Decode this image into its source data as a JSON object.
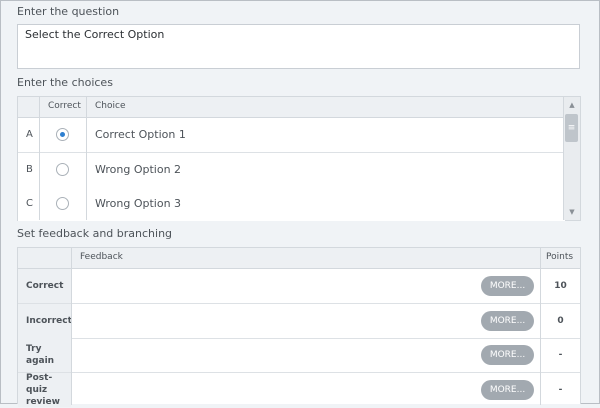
{
  "question": {
    "label": "Enter the question",
    "value": "Select the Correct Option"
  },
  "choices": {
    "label": "Enter the choices",
    "headers": {
      "correct": "Correct",
      "choice": "Choice"
    },
    "rows": [
      {
        "letter": "A",
        "text": "Correct Option 1",
        "selected": true
      },
      {
        "letter": "B",
        "text": "Wrong Option 2",
        "selected": false
      },
      {
        "letter": "C",
        "text": "Wrong Option 3",
        "selected": false
      }
    ],
    "scroll": {
      "up": "▲",
      "thumb": "≡",
      "down": "▼"
    }
  },
  "feedback": {
    "label": "Set feedback and branching",
    "headers": {
      "feedback": "Feedback",
      "points": "Points"
    },
    "rows": [
      {
        "label": "Correct",
        "button": "MORE...",
        "points": "10"
      },
      {
        "label": "Incorrect",
        "button": "MORE...",
        "points": "0"
      },
      {
        "label": "Try again",
        "button": "MORE...",
        "points": "-"
      },
      {
        "label": "Post-quiz review",
        "button": "MORE...",
        "points": "-"
      }
    ]
  },
  "colors": {
    "background": "#f0f3f6",
    "accent_radio": "#2e7fd0",
    "button": "#a2a9b0"
  }
}
